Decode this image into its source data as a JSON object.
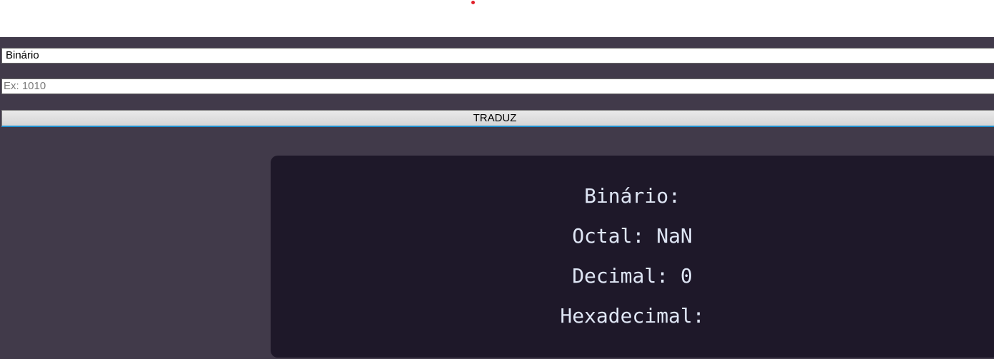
{
  "form": {
    "base_select": {
      "selected": "Binário"
    },
    "number_input": {
      "value": "",
      "placeholder": "Ex: 1010"
    },
    "translate_button": "TRADUZ"
  },
  "results": {
    "binary": "Binário:",
    "octal": "Octal: NaN",
    "decimal": "Decimal: 0",
    "hexadecimal": "Hexadecimal:"
  },
  "colors": {
    "background": "#413a4a",
    "panel": "#1e1829",
    "text": "#dfe6f5",
    "accent": "#1e90d0"
  }
}
